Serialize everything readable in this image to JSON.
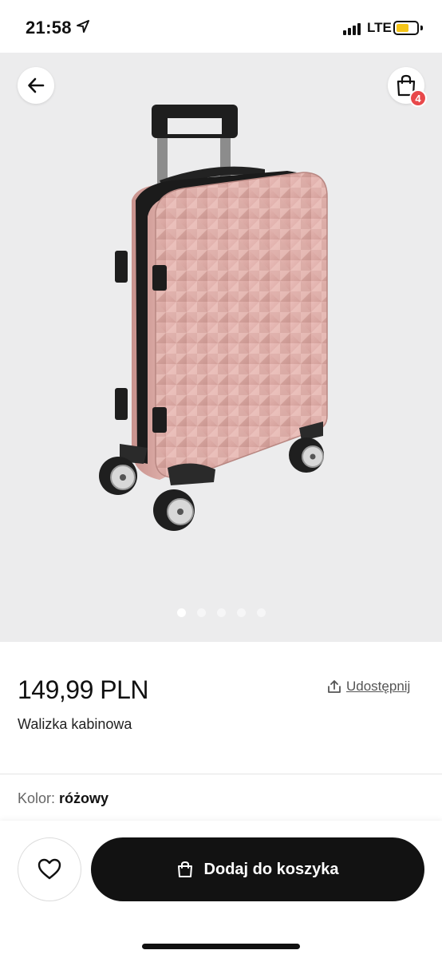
{
  "status": {
    "time": "21:58",
    "network": "LTE",
    "colors": {
      "battery": "#f5c518"
    }
  },
  "header": {
    "back_icon": "arrow-left-icon",
    "cart_icon": "shopping-bag-icon",
    "cart_count": "4",
    "colors": {
      "badge": "#e8484a"
    }
  },
  "gallery": {
    "image": "pink hard-shell cabin suitcase",
    "slides": 5,
    "active_slide": 1
  },
  "product": {
    "price": "149,99 PLN",
    "name": "Walizka kabinowa",
    "share_label": "Udostępnij",
    "share_icon": "share-icon",
    "color_label": "Kolor:",
    "color_value": "różowy"
  },
  "actions": {
    "favorite_icon": "heart-icon",
    "add_to_cart_label": "Dodaj do koszyka",
    "add_to_cart_icon": "shopping-bag-icon",
    "colors": {
      "button": "#121212"
    }
  }
}
